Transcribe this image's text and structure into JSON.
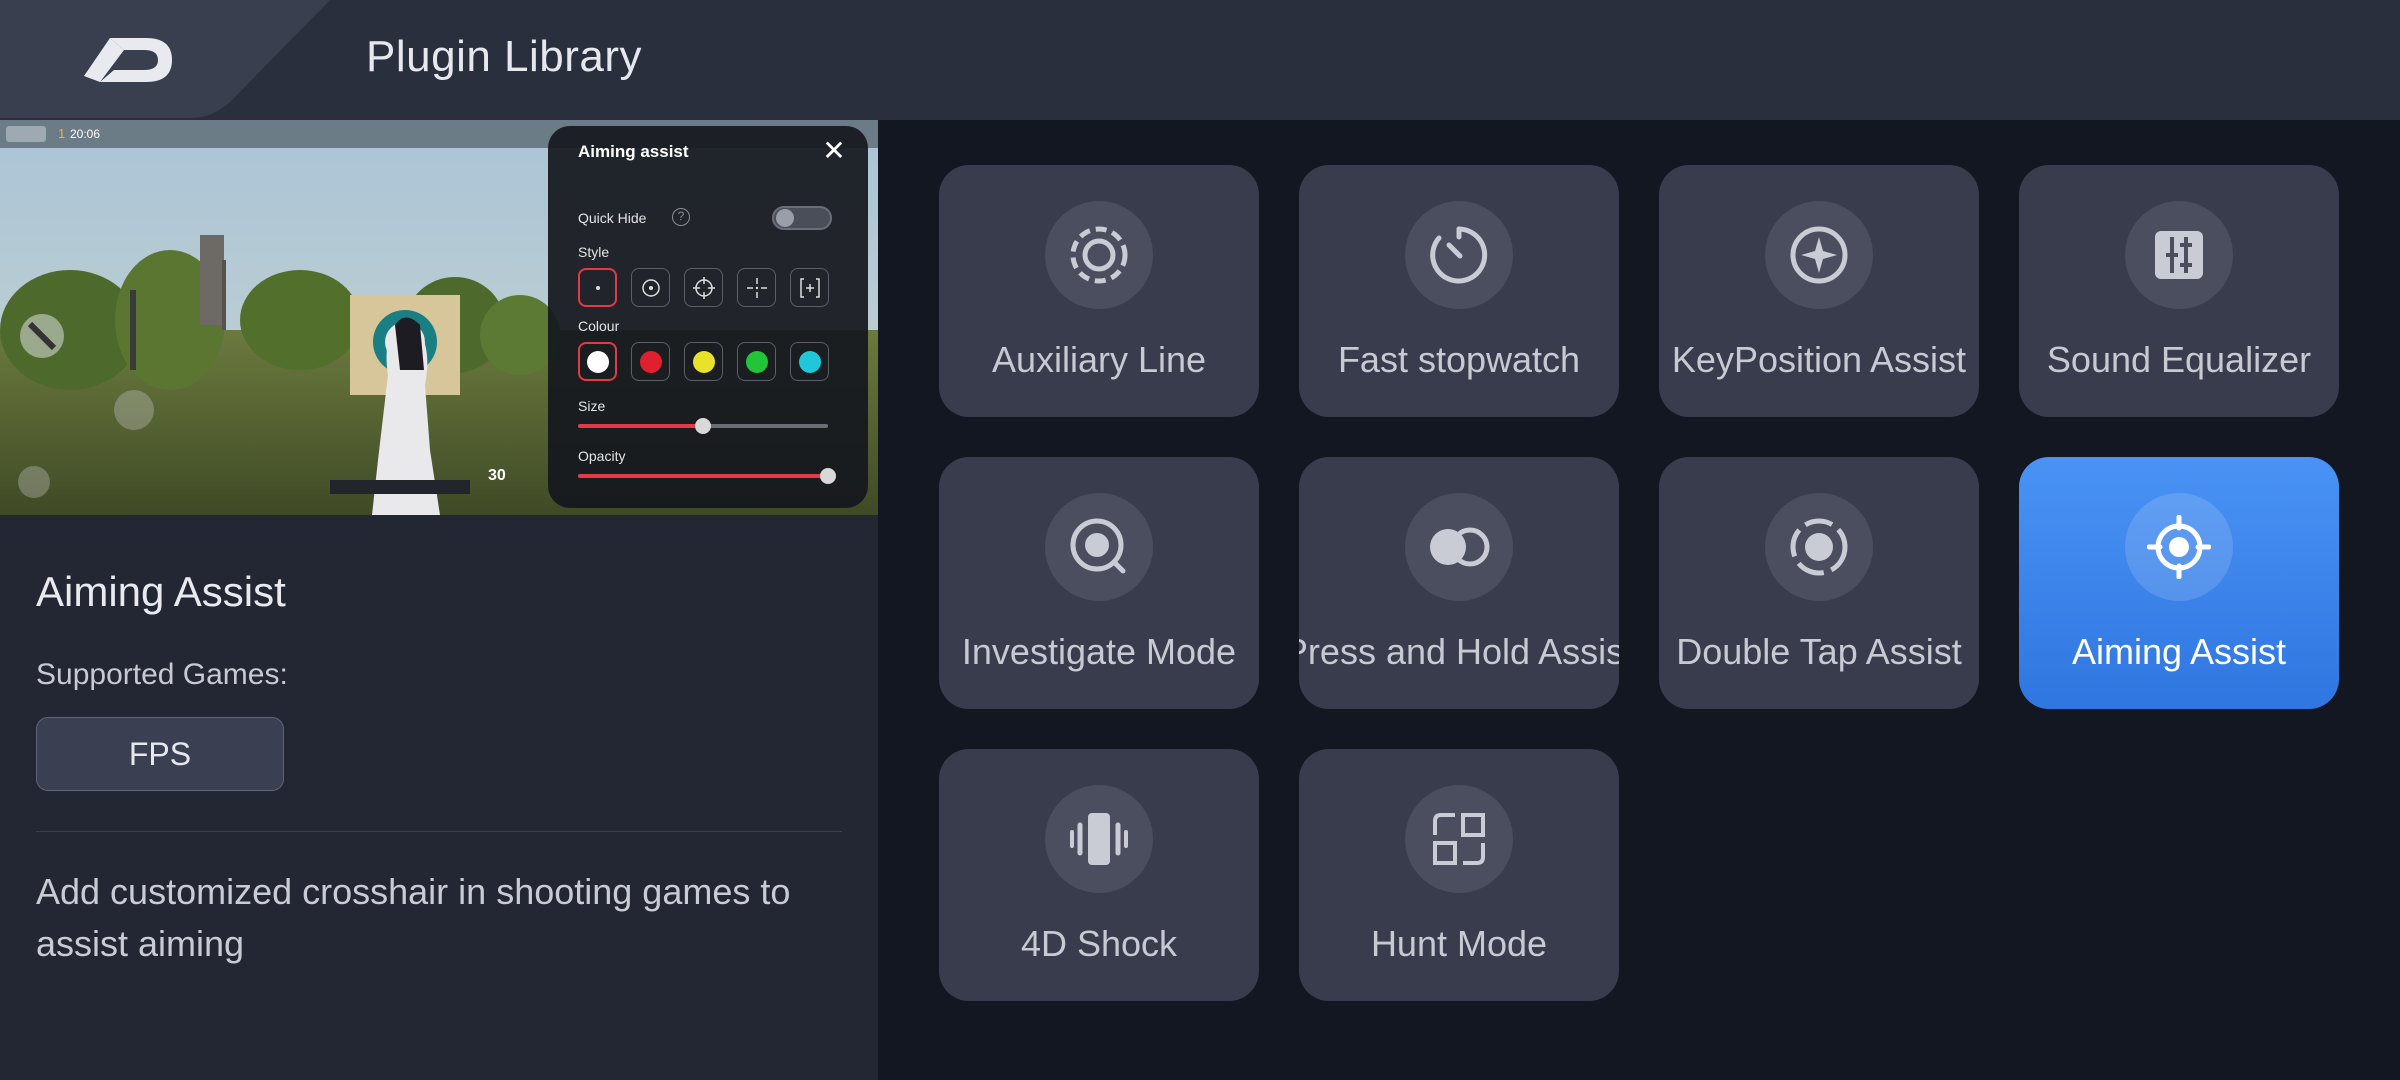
{
  "header": {
    "title": "Plugin Library",
    "back_icon": "back-arrow-icon"
  },
  "preview": {
    "hud": {
      "time": "20:06",
      "count": "30"
    },
    "popup": {
      "title": "Aiming assist",
      "close_symbol": "✕",
      "quick_hide_label": "Quick Hide",
      "help_symbol": "?",
      "quick_hide_on": false,
      "style_label": "Style",
      "styles": [
        "dot",
        "circle-dot",
        "crosshair-circle",
        "crosshair-gap",
        "bracket-plus"
      ],
      "selected_style": 0,
      "colour_label": "Colour",
      "colours": [
        "#ffffff",
        "#e0202e",
        "#e8e22a",
        "#22c43a",
        "#1fc8d8"
      ],
      "selected_colour": 0,
      "size_label": "Size",
      "size_value": 0.5,
      "opacity_label": "Opacity",
      "opacity_value": 1.0
    }
  },
  "details": {
    "name": "Aiming Assist",
    "supported_label": "Supported Games:",
    "games": [
      "FPS"
    ],
    "description": "Add customized crosshair in shooting games to assist aiming"
  },
  "plugins": [
    {
      "label": "Auxiliary Line",
      "icon": "dashed-ring-icon",
      "active": false
    },
    {
      "label": "Fast stopwatch",
      "icon": "stopwatch-icon",
      "active": false
    },
    {
      "label": "KeyPosition Assist",
      "icon": "compass-icon",
      "active": false
    },
    {
      "label": "Sound Equalizer",
      "icon": "equalizer-icon",
      "active": false
    },
    {
      "label": "Investigate Mode",
      "icon": "magnifier-icon",
      "active": false
    },
    {
      "label": "Press and Hold Assist",
      "icon": "hold-circles-icon",
      "active": false
    },
    {
      "label": "Double Tap Assist",
      "icon": "double-tap-icon",
      "active": false
    },
    {
      "label": "Aiming Assist",
      "icon": "crosshair-icon",
      "active": true
    },
    {
      "label": "4D Shock",
      "icon": "vibration-icon",
      "active": false
    },
    {
      "label": "Hunt Mode",
      "icon": "hunt-squares-icon",
      "active": false
    }
  ],
  "colors": {
    "accent": "#3a86f0",
    "popup_accent": "#e23a47"
  }
}
